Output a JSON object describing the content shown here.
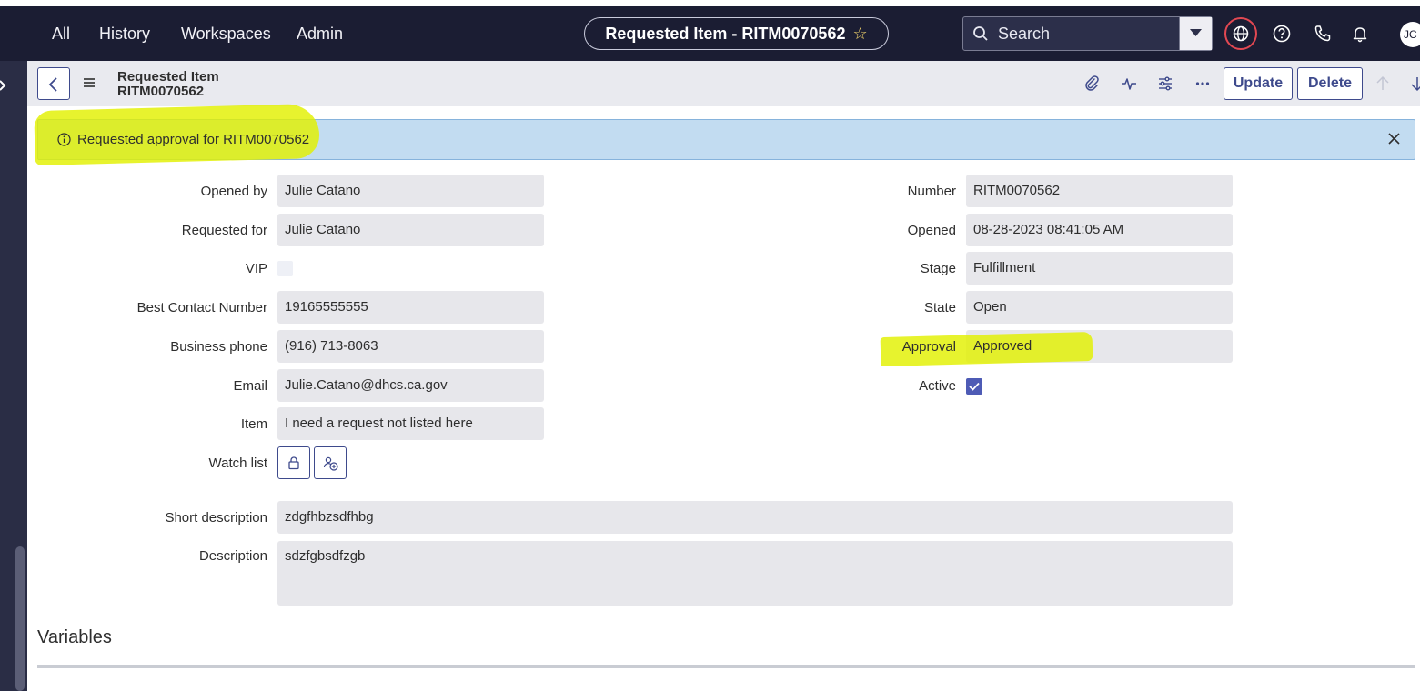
{
  "nav": {
    "items": [
      "All",
      "History",
      "Workspaces",
      "Admin"
    ],
    "record_title": "Requested Item - RITM0070562",
    "search_placeholder": "Search",
    "avatar_initials": "JC"
  },
  "form_header": {
    "table_label": "Requested Item",
    "record_number": "RITM0070562",
    "update_label": "Update",
    "delete_label": "Delete"
  },
  "alert": {
    "message": "Requested approval for RITM0070562"
  },
  "left_fields": {
    "opened_by": {
      "label": "Opened by",
      "value": "Julie Catano"
    },
    "requested_for": {
      "label": "Requested for",
      "value": "Julie Catano"
    },
    "vip": {
      "label": "VIP",
      "checked": false
    },
    "best_contact": {
      "label": "Best Contact Number",
      "value": "19165555555"
    },
    "business_phone": {
      "label": "Business phone",
      "value": "(916) 713-8063"
    },
    "email": {
      "label": "Email",
      "value": "Julie.Catano@dhcs.ca.gov"
    },
    "item": {
      "label": "Item",
      "value": "I need a request not listed here"
    },
    "watch_list": {
      "label": "Watch list"
    }
  },
  "right_fields": {
    "number": {
      "label": "Number",
      "value": "RITM0070562"
    },
    "opened": {
      "label": "Opened",
      "value": "08-28-2023 08:41:05 AM"
    },
    "stage": {
      "label": "Stage",
      "value": "Fulfillment"
    },
    "state": {
      "label": "State",
      "value": "Open"
    },
    "approval": {
      "label": "Approval",
      "value": "Approved"
    },
    "active": {
      "label": "Active",
      "checked": true
    }
  },
  "wide_fields": {
    "short_description": {
      "label": "Short description",
      "value": "zdgfhbzsdfhbg"
    },
    "description": {
      "label": "Description",
      "value": "sdzfgbsdfzgb"
    }
  },
  "sections": {
    "variables": "Variables"
  },
  "colors": {
    "nav_bg": "#1b1d33",
    "accent": "#3e4a8c",
    "alert_bg": "#c2dcf1",
    "highlight": "#e2f000",
    "field_bg": "#e7e7eb"
  }
}
